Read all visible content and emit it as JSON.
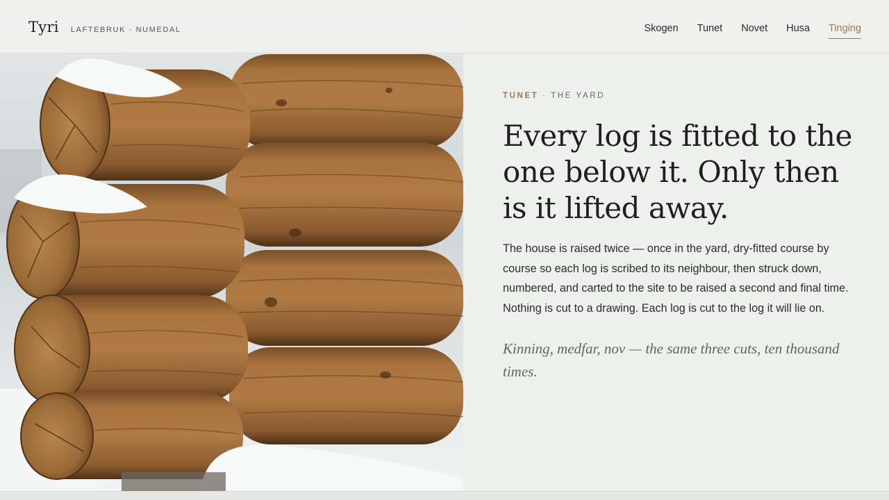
{
  "brand": {
    "name": "Tyri",
    "tagline": "LAFTEBRUK · NUMEDAL"
  },
  "nav": {
    "items": [
      {
        "label": "Skogen",
        "active": false
      },
      {
        "label": "Tunet",
        "active": false
      },
      {
        "label": "Novet",
        "active": false
      },
      {
        "label": "Husa",
        "active": false
      },
      {
        "label": "Tinging",
        "active": true
      }
    ]
  },
  "hero": {
    "image": "log-wall-corner-in-snow"
  },
  "section": {
    "eyebrow_accent": "TUNET",
    "eyebrow_sep": " · ",
    "eyebrow_rest": "THE YARD",
    "headline": "Every log is fitted to the one below it. Only then is it lifted away.",
    "body": "The house is raised twice — once in the yard, dry-fitted course by course so each log is scribed to its neighbour, then struck down, numbered, and carted to the site to be raised a second and final time. Nothing is cut to a drawing. Each log is cut to the log it will lie on.",
    "quote": "Kinning, medfar, nov — the same three cuts, ten thousand times."
  },
  "colors": {
    "accent": "#9a7a4a",
    "background": "#eef0ee",
    "text": "#1f1f1f"
  }
}
